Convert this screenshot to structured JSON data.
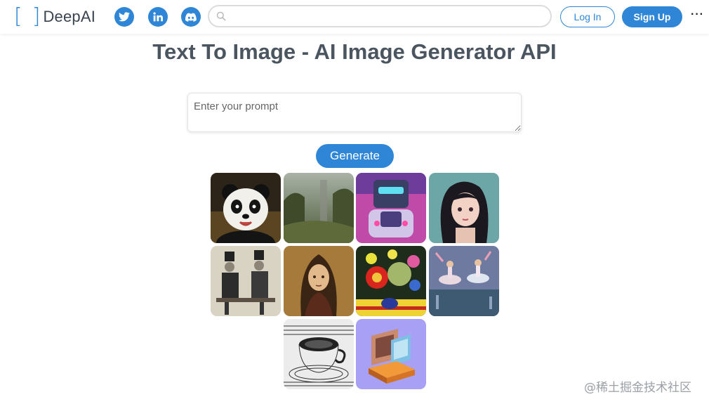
{
  "header": {
    "logo_open": "[",
    "logo_close": "]",
    "logo_text": "DeepAI",
    "social": [
      "twitter-icon",
      "linkedin-icon",
      "discord-icon"
    ],
    "search_placeholder": "",
    "login_label": "Log In",
    "signup_label": "Sign Up",
    "more_label": "···"
  },
  "main": {
    "title": "Text To Image - AI Image Generator API",
    "prompt_placeholder": "Enter your prompt",
    "generate_label": "Generate"
  },
  "gallery": {
    "images": [
      "panda",
      "forest-ruins",
      "robot",
      "anime-girl",
      "victorian-gentlemen",
      "renaissance-portrait",
      "flower-bouquet",
      "ballet-dancers",
      "teacup-engraving",
      "isometric-computer"
    ]
  },
  "watermark": "@稀土掘金技术社区",
  "colors": {
    "accent": "#2f86d6",
    "title": "#4a5560"
  }
}
